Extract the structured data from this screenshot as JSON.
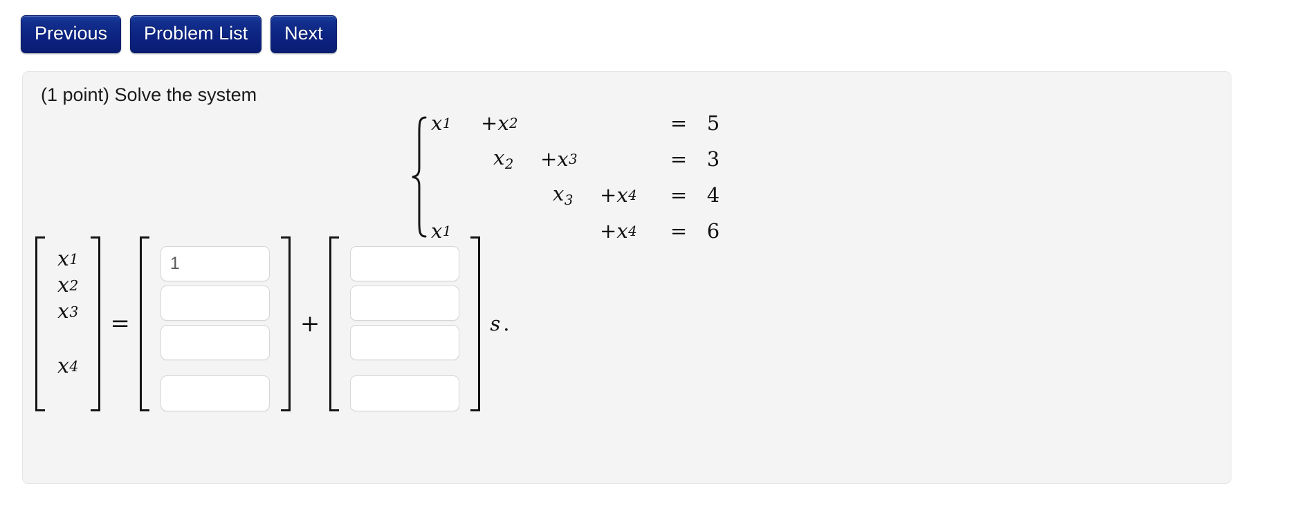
{
  "nav": {
    "buttons": [
      {
        "id": "previous",
        "label": "Previous"
      },
      {
        "id": "problem-list",
        "label": "Problem List"
      },
      {
        "id": "next",
        "label": "Next"
      }
    ]
  },
  "problem": {
    "statement": "(1 point) Solve the system",
    "points": "1 point",
    "system": {
      "brace": "{",
      "variables": [
        "x1",
        "x2",
        "x3",
        "x4"
      ],
      "equations": [
        {
          "terms": [
            "x1",
            "+x2",
            "",
            ""
          ],
          "relation": "=",
          "rhs": "5"
        },
        {
          "terms": [
            "",
            "x2",
            "+x3",
            ""
          ],
          "relation": "=",
          "rhs": "3"
        },
        {
          "terms": [
            "",
            "",
            "x3",
            "+x4"
          ],
          "relation": "=",
          "rhs": "4"
        },
        {
          "terms": [
            "x1",
            "",
            "",
            "+x4"
          ],
          "relation": "=",
          "rhs": "6"
        }
      ]
    },
    "answer": {
      "lhs_vector": [
        "x1",
        "x2",
        "x3",
        "x4"
      ],
      "equals_sign": "=",
      "plus_sign": "+",
      "particular_vector": {
        "values": [
          "1",
          "",
          "",
          ""
        ],
        "placeholders": [
          "",
          "",
          "",
          ""
        ]
      },
      "direction_vector": {
        "values": [
          "",
          "",
          "",
          ""
        ],
        "placeholders": [
          "",
          "",
          "",
          ""
        ]
      },
      "scalar_label": "s",
      "scalar_dot": "."
    }
  },
  "colors": {
    "button_blue_top": "#1b3fa0",
    "button_blue_bottom": "#0a1d72",
    "panel_bg": "#f4f4f4",
    "panel_border": "#e4e4e4",
    "input_border": "#d6d6d6",
    "input_text": "#5c5c5c",
    "page_bg": "#ffffff"
  }
}
